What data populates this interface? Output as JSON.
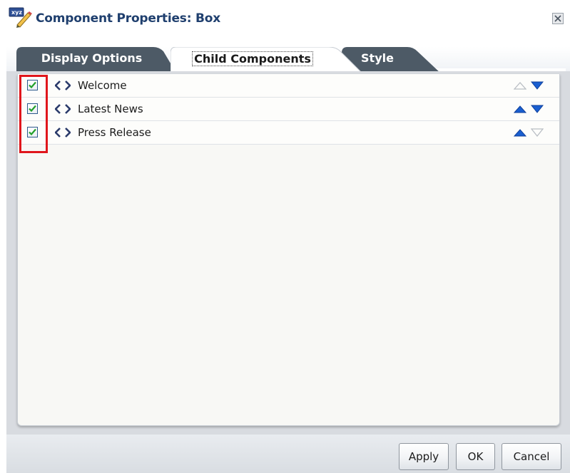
{
  "dialog": {
    "title": "Component Properties: Box",
    "title_icon": "edit-properties-icon",
    "close_icon": "close-icon"
  },
  "tabs": [
    {
      "label": "Display Options",
      "active": false
    },
    {
      "label": "Child Components",
      "active": true
    },
    {
      "label": "Style",
      "active": false
    }
  ],
  "components": [
    {
      "label": "Welcome",
      "checked": true,
      "icon": "code-icon",
      "move_up_enabled": false,
      "move_down_enabled": true
    },
    {
      "label": "Latest News",
      "checked": true,
      "icon": "code-icon",
      "move_up_enabled": true,
      "move_down_enabled": true
    },
    {
      "label": "Press Release",
      "checked": true,
      "icon": "code-icon",
      "move_up_enabled": true,
      "move_down_enabled": false
    }
  ],
  "buttons": {
    "apply": "Apply",
    "ok": "OK",
    "cancel": "Cancel"
  },
  "colors": {
    "title": "#1f3f6e",
    "inactive_tab": "#4d5a66",
    "arrow_enabled": "#1a5fd0",
    "arrow_disabled": "#b9bec4",
    "checkmark": "#22a02a",
    "highlight": "#e0161c"
  }
}
